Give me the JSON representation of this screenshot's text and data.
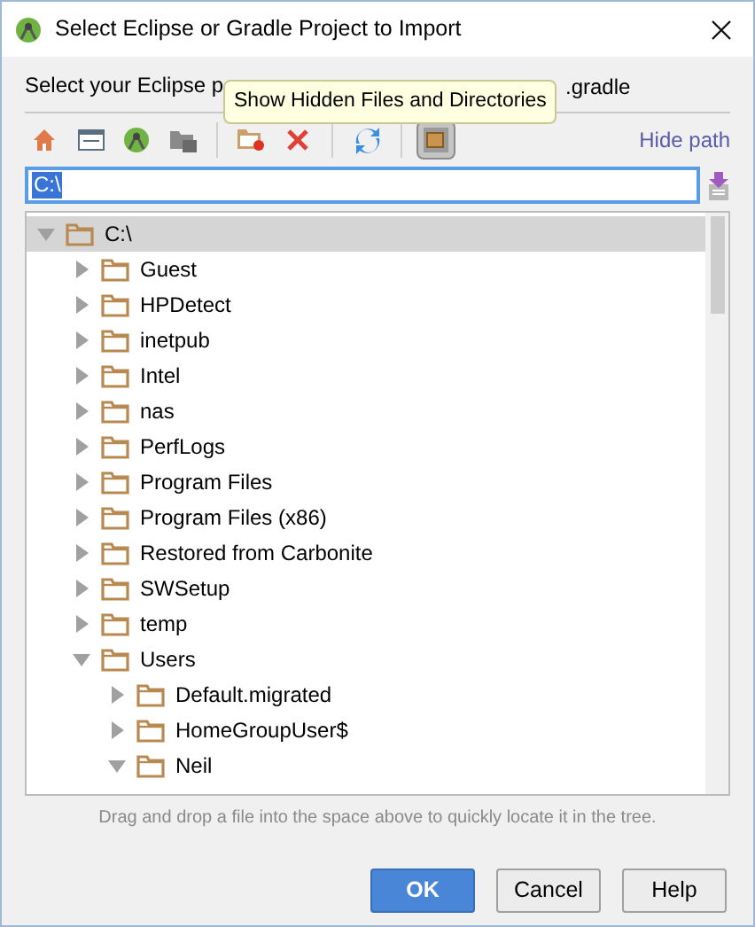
{
  "window": {
    "title": "Select Eclipse or Gradle Project to Import"
  },
  "instruction": {
    "visible_start": "Select your Eclipse p",
    "visible_end": ".gradle"
  },
  "tooltip": "Show Hidden Files and Directories",
  "toolbar": [
    {
      "kind": "home",
      "pressed": false
    },
    {
      "kind": "desktop",
      "pressed": false
    },
    {
      "kind": "android",
      "pressed": false
    },
    {
      "kind": "module",
      "pressed": false
    },
    {
      "kind": "separator"
    },
    {
      "kind": "new-folder",
      "pressed": false
    },
    {
      "kind": "delete",
      "pressed": false
    },
    {
      "kind": "separator"
    },
    {
      "kind": "refresh",
      "pressed": false
    },
    {
      "kind": "separator"
    },
    {
      "kind": "hidden",
      "pressed": true
    }
  ],
  "hide_path": "Hide path",
  "path_field": {
    "value": "C:\\",
    "text_selected": true
  },
  "tree": [
    {
      "label": "C:\\",
      "expanded": true,
      "selected": true,
      "children": [
        {
          "label": "Guest",
          "expanded": false,
          "selected": false
        },
        {
          "label": "HPDetect",
          "expanded": false,
          "selected": false
        },
        {
          "label": "inetpub",
          "expanded": false,
          "selected": false
        },
        {
          "label": "Intel",
          "expanded": false,
          "selected": false
        },
        {
          "label": "nas",
          "expanded": false,
          "selected": false
        },
        {
          "label": "PerfLogs",
          "expanded": false,
          "selected": false
        },
        {
          "label": "Program Files",
          "expanded": false,
          "selected": false
        },
        {
          "label": "Program Files (x86)",
          "expanded": false,
          "selected": false
        },
        {
          "label": "Restored from Carbonite",
          "expanded": false,
          "selected": false
        },
        {
          "label": "SWSetup",
          "expanded": false,
          "selected": false
        },
        {
          "label": "temp",
          "expanded": false,
          "selected": false
        },
        {
          "label": "Users",
          "expanded": true,
          "selected": false,
          "children": [
            {
              "label": "Default.migrated",
              "expanded": false,
              "selected": false
            },
            {
              "label": "HomeGroupUser$",
              "expanded": false,
              "selected": false
            },
            {
              "label": "Neil",
              "expanded": true,
              "selected": false
            }
          ]
        }
      ]
    }
  ],
  "hint": "Drag and drop a file into the space above to quickly locate it in the tree.",
  "buttons": [
    {
      "label": "OK",
      "default": true
    },
    {
      "label": "Cancel",
      "default": false
    },
    {
      "label": "Help",
      "default": false
    }
  ]
}
